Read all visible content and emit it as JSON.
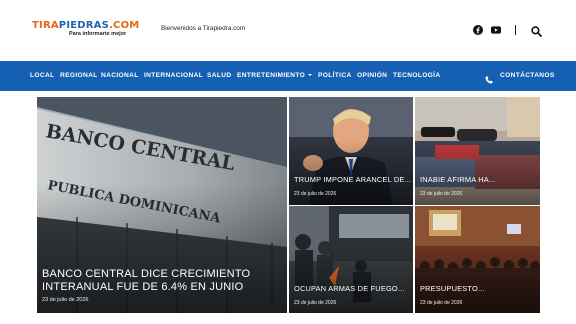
{
  "header": {
    "logo_part1": "TIRA",
    "logo_part2": "PIEDRAS",
    "logo_part3": ".COM",
    "tagline": "Para informarte mejor",
    "welcome": "Bienvenidos a Tirapiedra.com",
    "icons": [
      "facebook-icon",
      "youtube-icon",
      "search-icon"
    ]
  },
  "nav": {
    "items": [
      "LOCAL",
      "REGIONAL",
      "NACIONAL",
      "INTERNACIONAL",
      "SALUD",
      "ENTRETENIMIENTO",
      "POLÍTICA",
      "OPINIÓN",
      "TECNOLOGÍA"
    ],
    "contact": "CONTÁCTANOS"
  },
  "colors": {
    "brand_orange": "#e8661a",
    "brand_blue": "#1e64b4",
    "nav_bg": "#1660b3"
  },
  "articles": [
    {
      "headline": "BANCO CENTRAL DICE CRECIMIENTO INTERANUAL FUE DE 6.4% EN JUNIO",
      "date": "23 de julio de 2026"
    },
    {
      "headline": "TRUMP IMPONE ARANCEL DE...",
      "date": "23 de julio de 2026"
    },
    {
      "headline": "INABIE AFIRMA HA...",
      "date": "23 de julio de 2026"
    },
    {
      "headline": "OCUPAN ARMAS DE FUEGO...",
      "date": "23 de julio de 2026"
    },
    {
      "headline": "PRESUPUESTO...",
      "date": "23 de julio de 2026"
    }
  ]
}
